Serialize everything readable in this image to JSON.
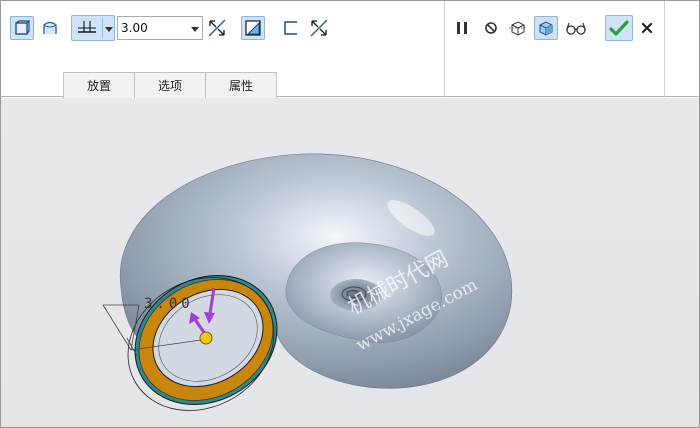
{
  "toolbar": {
    "depth_value": "3.00",
    "tools": [
      {
        "name": "solid-icon",
        "active": true
      },
      {
        "name": "surface-icon",
        "active": false
      },
      {
        "name": "depth-option-icon",
        "active": true
      },
      {
        "name": "flip-depth-icon",
        "active": false
      },
      {
        "name": "remove-material-icon",
        "active": true
      },
      {
        "name": "thicken-icon",
        "active": false
      },
      {
        "name": "flip-thicken-icon",
        "active": false
      }
    ],
    "controls": [
      {
        "name": "pause-icon"
      },
      {
        "name": "no-preview-icon"
      },
      {
        "name": "geometry-preview-icon"
      },
      {
        "name": "feature-preview-icon",
        "active": true
      },
      {
        "name": "verify-glasses-icon"
      },
      {
        "name": "ok-check-icon",
        "active": true
      },
      {
        "name": "cancel-x-icon"
      }
    ]
  },
  "tabs": [
    {
      "label": "放置"
    },
    {
      "label": "选项"
    },
    {
      "label": "属性"
    }
  ],
  "viewport": {
    "dimension_text": "3.00",
    "watermark_cn": "机械时代网",
    "watermark_en": "www.jxage.com"
  },
  "colors": {
    "accent_blue": "#cfe3f7",
    "check_green": "#2e9b3f",
    "part_gray": "#a8b4c2",
    "section_orange": "#c8860a",
    "handle_yellow": "#f5c518",
    "arrow_purple": "#a33fd0"
  }
}
